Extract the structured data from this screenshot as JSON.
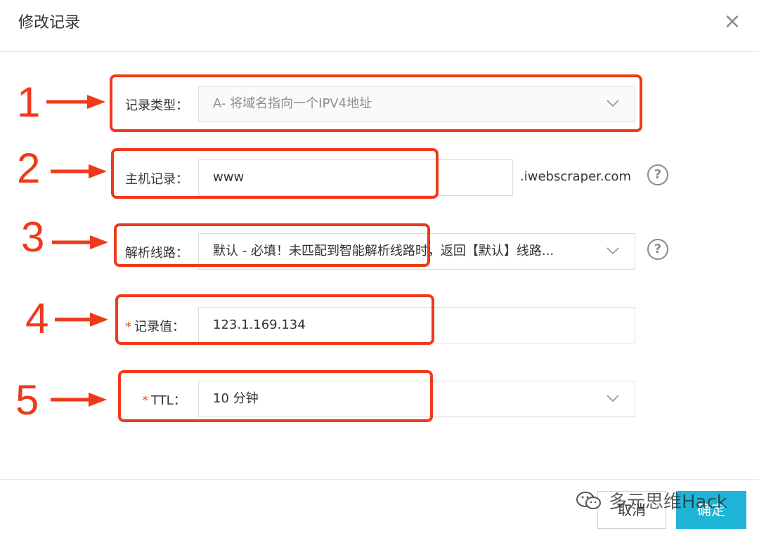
{
  "dialog": {
    "title": "修改记录",
    "close_glyph": "×"
  },
  "form": {
    "record_type": {
      "label": "记录类型：",
      "value": "A- 将域名指向一个IPV4地址"
    },
    "host": {
      "label": "主机记录：",
      "value": "www",
      "suffix": ".iwebscraper.com"
    },
    "line": {
      "label": "解析线路：",
      "value": "默认 - 必填！未匹配到智能解析线路时，返回【默认】线路..."
    },
    "record_value": {
      "required_mark": "*",
      "label": "记录值：",
      "value": "123.1.169.134"
    },
    "ttl": {
      "required_mark": "*",
      "label": "TTL：",
      "value": "10 分钟"
    },
    "help_glyph": "?"
  },
  "annotations": [
    "1",
    "2",
    "3",
    "4",
    "5"
  ],
  "footer": {
    "cancel_label": "取消",
    "ok_label": "确定",
    "watermark_text": "多元思维Hack"
  },
  "colors": {
    "annotation": "#f0391a",
    "primary_button": "#1fb5d9",
    "required": "#e8541e"
  },
  "icons": {
    "close": "close-icon",
    "dropdown": "chevron-down-icon",
    "help": "help-icon",
    "watermark": "wechat-icon"
  }
}
